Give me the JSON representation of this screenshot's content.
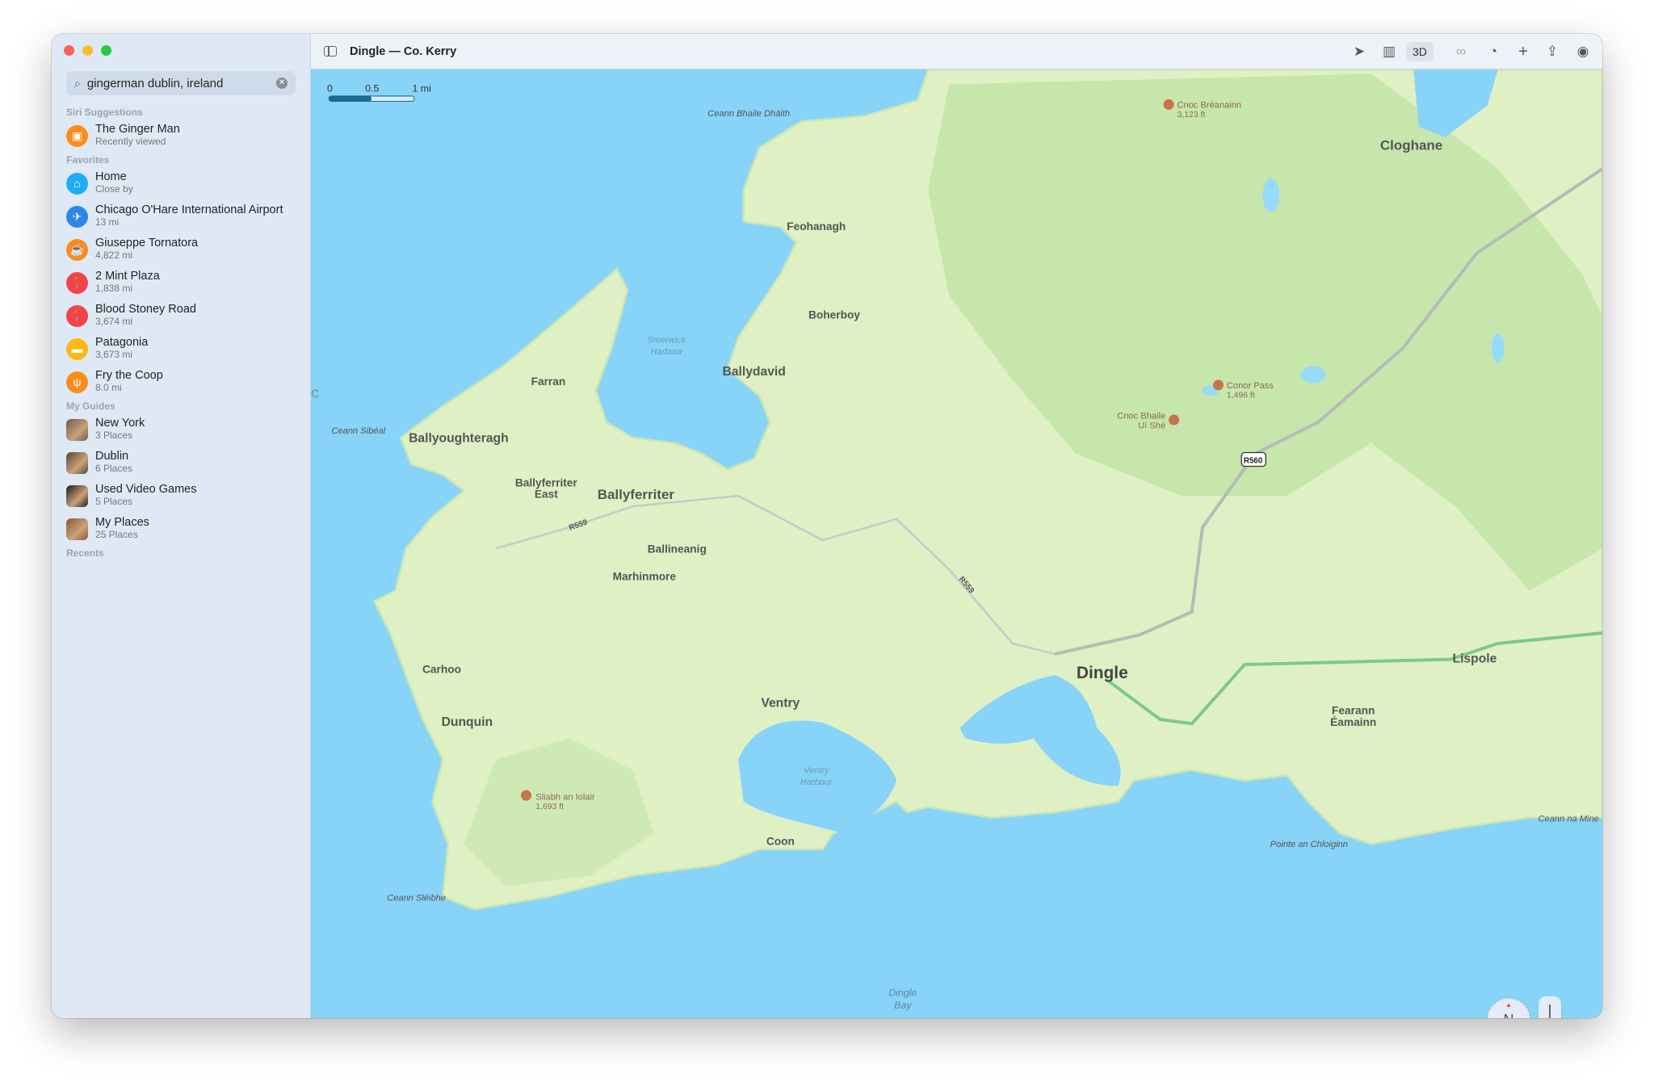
{
  "window": {
    "title": "Dingle — Co. Kerry",
    "lights": [
      "#fe5f57",
      "#febc2e",
      "#28c840"
    ]
  },
  "search": {
    "value": "gingerman dublin, ireland",
    "icon": "search-icon",
    "clear_icon": "clear-icon"
  },
  "sidebar": {
    "sections": {
      "siri": "Siri Suggestions",
      "favorites": "Favorites",
      "guides": "My Guides",
      "recents": "Recents"
    },
    "siri": [
      {
        "title": "The Ginger Man",
        "sub": "Recently viewed",
        "icon": "beer-icon",
        "color": "#fb8c1e"
      }
    ],
    "favorites": [
      {
        "title": "Home",
        "sub": "Close by",
        "icon": "house-icon",
        "color": "#1eaef5"
      },
      {
        "title": "Chicago O'Hare International Airport",
        "sub": "13 mi",
        "icon": "airplane-icon",
        "color": "#2d86e8"
      },
      {
        "title": "Giuseppe Tornatora",
        "sub": "4,822 mi",
        "icon": "cup-icon",
        "color": "#fb8c1e"
      },
      {
        "title": "2 Mint Plaza",
        "sub": "1,838 mi",
        "icon": "pin-icon",
        "color": "#f2434a"
      },
      {
        "title": "Blood Stoney Road",
        "sub": "3,674 mi",
        "icon": "pin-icon",
        "color": "#f2434a"
      },
      {
        "title": "Patagonia",
        "sub": "3,673 mi",
        "icon": "bag-icon",
        "color": "#fdb814"
      },
      {
        "title": "Fry the Coop",
        "sub": "8.0 mi",
        "icon": "fork-knife-icon",
        "color": "#fb8c1e"
      }
    ],
    "guides": [
      {
        "title": "New York",
        "sub": "3 Places",
        "thumb": "#6d5a4a"
      },
      {
        "title": "Dublin",
        "sub": "6 Places",
        "thumb": "#5a4330"
      },
      {
        "title": "Used Video Games",
        "sub": "5 Places",
        "thumb": "#1e1a18"
      },
      {
        "title": "My Places",
        "sub": "25 Places",
        "thumb": "#8a5a35"
      }
    ]
  },
  "toolbar": {
    "sidebar_icon": "sidebar-icon",
    "buttons": [
      "location-icon",
      "map-icon",
      "3D",
      "binoculars-icon",
      "look-around-icon",
      "plus-icon",
      "share-icon",
      "account-icon"
    ],
    "three_d": "3D"
  },
  "map": {
    "scale": {
      "ticks": [
        "0",
        "0.5",
        "1 mi"
      ],
      "fill_fraction": 0.5
    },
    "labels": [
      "Ceann Bhaile Dháith",
      "Cnoc Bréanainn",
      "3,123 ft",
      "Cloghane",
      "Feohanagh",
      "Boherboy",
      "Smerwick",
      "Harbour",
      "Ballydavid",
      "Farran",
      "Ceann Sibéal",
      "Ballyoughteragh",
      "Conor Pass",
      "1,496 ft",
      "Cnoc Bhaile",
      "Uí Shé",
      "R560",
      "Ballyferriter",
      "East",
      "Ballyferriter",
      "R559",
      "R559",
      "Ballineanig",
      "Marhinmore",
      "Dingle",
      "Lispole",
      "Carhoo",
      "Ventry",
      "Dunquin",
      "Fearann",
      "Éamainn",
      "Ventry",
      "Harbour",
      "Sliabh an Iolair",
      "1,693 ft",
      "Coon",
      "Pointe an Chloiginn",
      "Ceann na Mine",
      "Ceann Sléibhe",
      "Dingle",
      "Bay",
      "C"
    ],
    "colors": {
      "water": "#88d3f8",
      "land": "#def0c4",
      "hills": "#bfe3a6",
      "route": "#7cc98a",
      "road": "#b5bab8",
      "peak": "#c8744a"
    }
  },
  "controls": {
    "zoom_out": "−",
    "zoom_in": "+",
    "compass": "N"
  }
}
